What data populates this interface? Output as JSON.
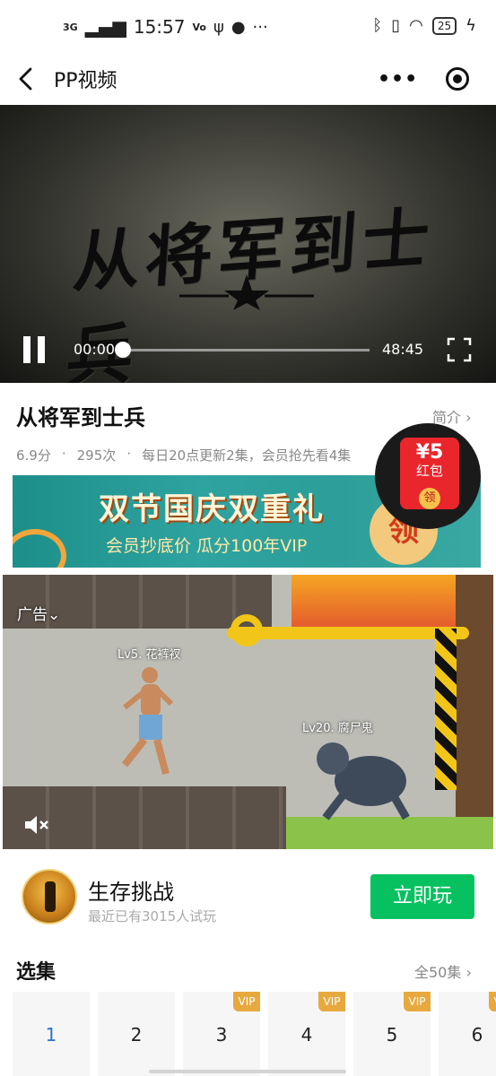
{
  "status": {
    "network": "3G",
    "time": "15:57",
    "volte": "Vo",
    "battery": "25"
  },
  "nav": {
    "title": "PP视频",
    "more_glyph": "•••"
  },
  "video": {
    "title_art": "从将军到士兵",
    "current_time": "00:00",
    "total_time": "48:45",
    "progress": 0
  },
  "info": {
    "title": "从将军到士兵",
    "intro": "简介 ›",
    "rating": "6.9分",
    "views": "295次",
    "schedule": "每日20点更新2集，会员抢先看4集"
  },
  "red_packet": {
    "amount": "¥5",
    "label": "红包",
    "claim": "领"
  },
  "banner": {
    "title": "双节国庆双重礼",
    "subtitle": "会员抄底价 瓜分100年VIP",
    "claim": "领"
  },
  "ad": {
    "label": "广告⌄",
    "player_level": "Lv5. 花裤衩",
    "enemy_level": "Lv20. 腐尸鬼"
  },
  "game": {
    "name": "生存挑战",
    "subtitle": "最近已有3015人试玩",
    "play_button": "立即玩"
  },
  "episodes": {
    "header": "选集",
    "all_label": "全50集 ›",
    "vip_label": "VIP",
    "items": [
      {
        "num": "1",
        "vip": false,
        "active": true
      },
      {
        "num": "2",
        "vip": false,
        "active": false
      },
      {
        "num": "3",
        "vip": true,
        "active": false
      },
      {
        "num": "4",
        "vip": true,
        "active": false
      },
      {
        "num": "5",
        "vip": true,
        "active": false
      },
      {
        "num": "6",
        "vip": true,
        "active": false
      }
    ]
  },
  "colors": {
    "accent_green": "#07c160",
    "vip_gold": "#e7a93e",
    "active_blue": "#2a73c7",
    "red_packet": "#e8262c"
  }
}
